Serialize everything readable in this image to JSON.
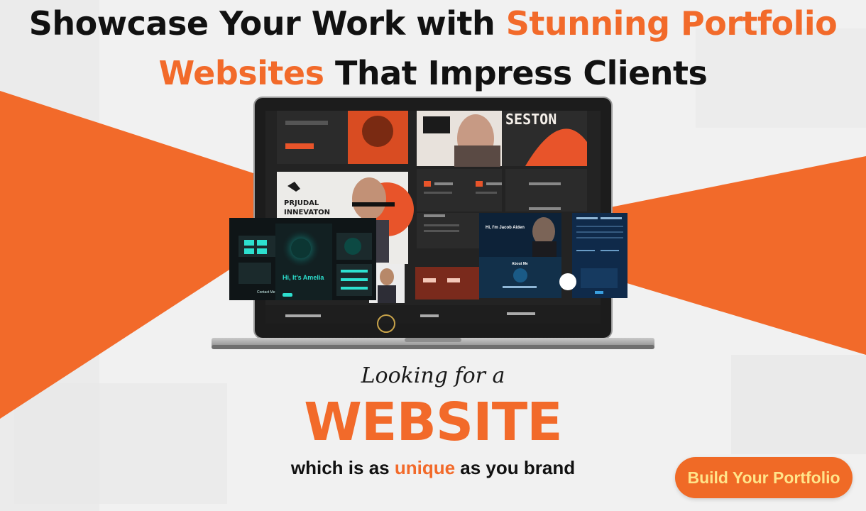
{
  "headline": {
    "line1_text": "Showcase Your Work with ",
    "line1_highlight": "Stunning Portfolio",
    "line2_highlight": "Websites",
    "line2_text": " That Impress Clients"
  },
  "laptop_screen": {
    "brand_title": "SESTON",
    "poster_title_a": "PRJUDAL",
    "poster_title_b": "INNEVATON",
    "card_left_heading": "Hi, It's Amelia",
    "card_left_contact": "Contact Me",
    "card_mid_heading": "Hi, I'm Jacob Aiden",
    "card_mid_about": "About Me"
  },
  "subcopy": {
    "looking_for": "Looking for a",
    "website": "WEBSITE",
    "tagline_pre": "which is as ",
    "tagline_highlight": "unique",
    "tagline_post": " as you brand"
  },
  "cta": {
    "label": "Build Your Portfolio"
  },
  "colors": {
    "accent": "#f26a2a",
    "cta_text": "#ffe48a"
  }
}
